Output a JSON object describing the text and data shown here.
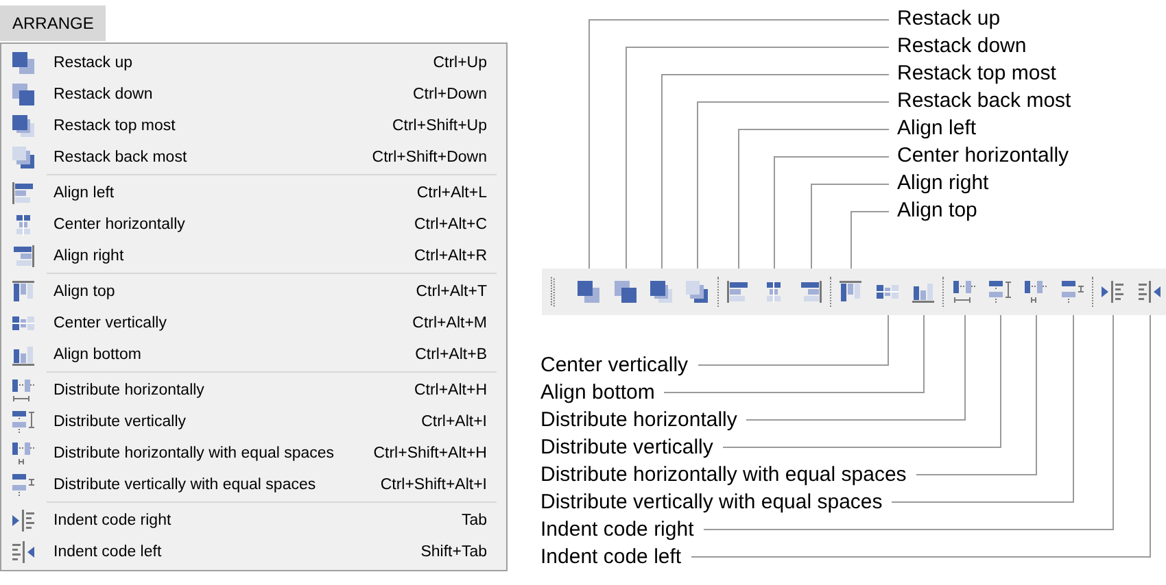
{
  "menu": {
    "title": "ARRANGE",
    "sections": [
      {
        "items": [
          {
            "label": "Restack up",
            "shortcut": "Ctrl+Up"
          },
          {
            "label": "Restack down",
            "shortcut": "Ctrl+Down"
          },
          {
            "label": "Restack top most",
            "shortcut": "Ctrl+Shift+Up"
          },
          {
            "label": "Restack back most",
            "shortcut": "Ctrl+Shift+Down"
          }
        ]
      },
      {
        "items": [
          {
            "label": "Align left",
            "shortcut": "Ctrl+Alt+L"
          },
          {
            "label": "Center horizontally",
            "shortcut": "Ctrl+Alt+C"
          },
          {
            "label": "Align right",
            "shortcut": "Ctrl+Alt+R"
          }
        ]
      },
      {
        "items": [
          {
            "label": "Align top",
            "shortcut": "Ctrl+Alt+T"
          },
          {
            "label": "Center vertically",
            "shortcut": "Ctrl+Alt+M"
          },
          {
            "label": "Align bottom",
            "shortcut": "Ctrl+Alt+B"
          }
        ]
      },
      {
        "items": [
          {
            "label": "Distribute horizontally",
            "shortcut": "Ctrl+Alt+H"
          },
          {
            "label": "Distribute vertically",
            "shortcut": "Ctrl+Alt+I"
          },
          {
            "label": "Distribute horizontally with equal spaces",
            "shortcut": "Ctrl+Shift+Alt+H"
          },
          {
            "label": "Distribute vertically with equal spaces",
            "shortcut": "Ctrl+Shift+Alt+I"
          }
        ]
      },
      {
        "items": [
          {
            "label": "Indent code right",
            "shortcut": "Tab"
          },
          {
            "label": "Indent code left",
            "shortcut": "Shift+Tab"
          }
        ]
      }
    ]
  },
  "toolbar": {
    "callouts_above": [
      "Restack up",
      "Restack down",
      "Restack top most",
      "Restack back most",
      "Align left",
      "Center horizontally",
      "Align right",
      "Align top"
    ],
    "callouts_below": [
      "Center vertically",
      "Align bottom",
      "Distribute horizontally",
      "Distribute vertically",
      "Distribute horizontally with equal spaces",
      "Distribute vertically with equal spaces",
      "Indent code right",
      "Indent code left"
    ]
  }
}
